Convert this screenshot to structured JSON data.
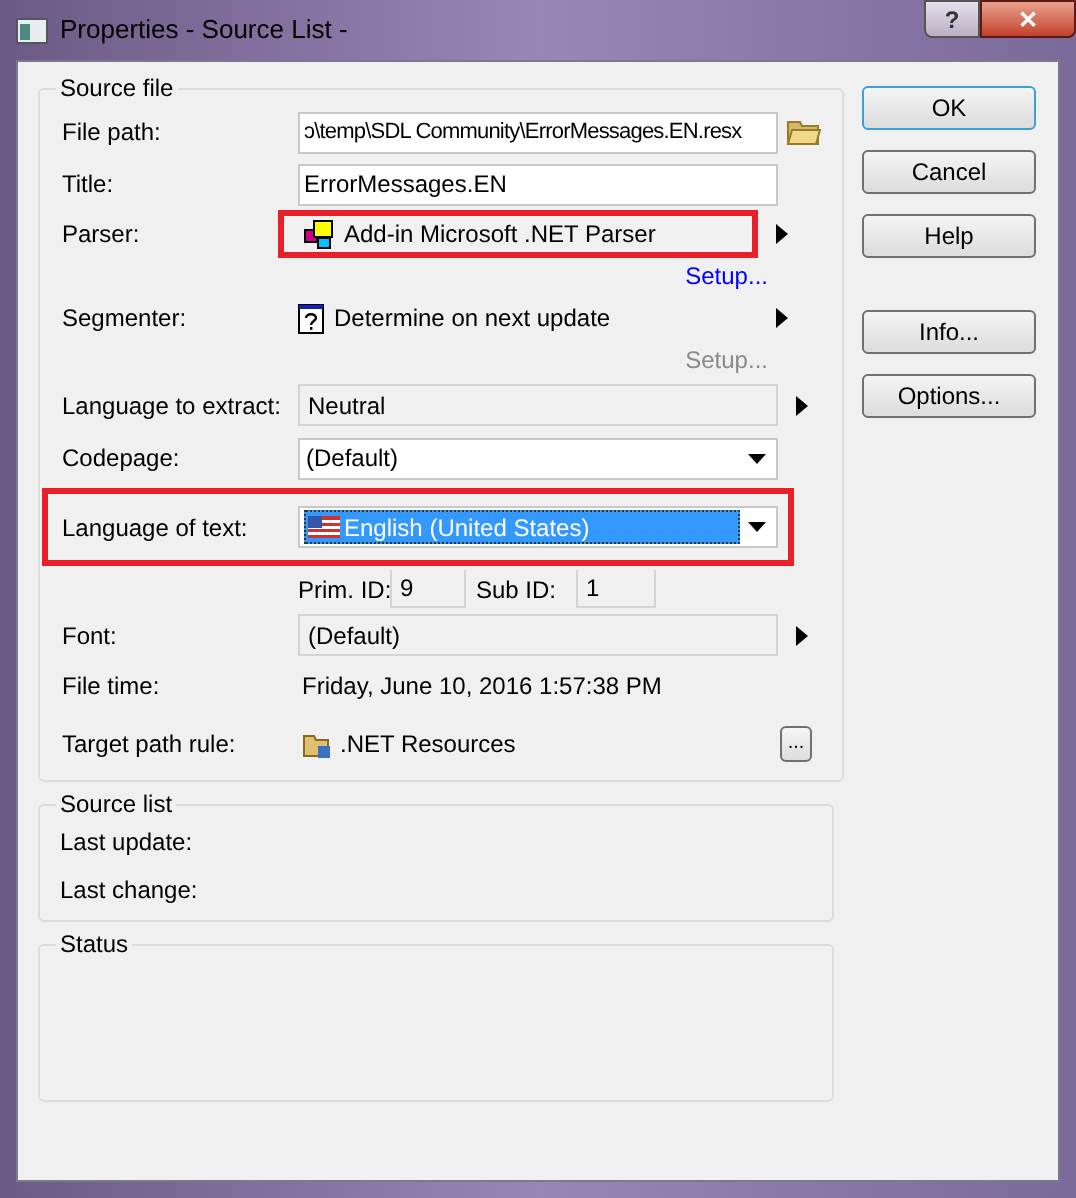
{
  "window": {
    "title": "Properties - Source List -",
    "help_button": "?",
    "close_button": "✕"
  },
  "source_file": {
    "title": "Source file",
    "fields": [
      {
        "kind": "input",
        "label": "File path:",
        "value": "ɔ\\temp\\SDL Community\\ErrorMessages.EN.resx"
      },
      {
        "kind": "input",
        "label": "Title:",
        "value": "ErrorMessages.EN"
      },
      {
        "kind": "module",
        "label": "Parser:",
        "value": "Add-in Microsoft .NET Parser",
        "highlighted": true,
        "setup": {
          "label": "Setup...",
          "disabled": false
        }
      },
      {
        "kind": "module",
        "label": "Segmenter:",
        "value": "Determine on next update",
        "highlighted": false,
        "setup": {
          "label": "Setup...",
          "disabled": true
        }
      },
      {
        "kind": "readonly",
        "label": "Language to extract:",
        "value": "Neutral"
      },
      {
        "kind": "combo",
        "label": "Codepage:",
        "value": "(Default)",
        "selected": false,
        "highlighted": false
      },
      {
        "kind": "combo",
        "label": "Language of text:",
        "value": "English (United States)",
        "selected": true,
        "highlighted": true
      },
      {
        "kind": "ids",
        "primary_label": "Prim. ID:",
        "primary_value": "9",
        "sub_label": "Sub ID:",
        "sub_value": "1"
      },
      {
        "kind": "readonly",
        "label": "Font:",
        "value": "(Default)"
      },
      {
        "kind": "text",
        "label": "File time:",
        "value": "Friday, June 10, 2016 1:57:38 PM"
      },
      {
        "kind": "path",
        "label": "Target path rule:",
        "value": ".NET Resources",
        "button": "..."
      }
    ]
  },
  "source_list": {
    "title": "Source list",
    "labels": [
      "Last update:",
      "Last change:"
    ]
  },
  "status": {
    "title": "Status"
  },
  "buttons": [
    {
      "label": "OK",
      "default": true
    },
    {
      "label": "Cancel",
      "default": false
    },
    {
      "label": "Help",
      "default": false
    },
    {
      "label": "Info...",
      "default": false
    },
    {
      "label": "Options...",
      "default": false
    }
  ]
}
